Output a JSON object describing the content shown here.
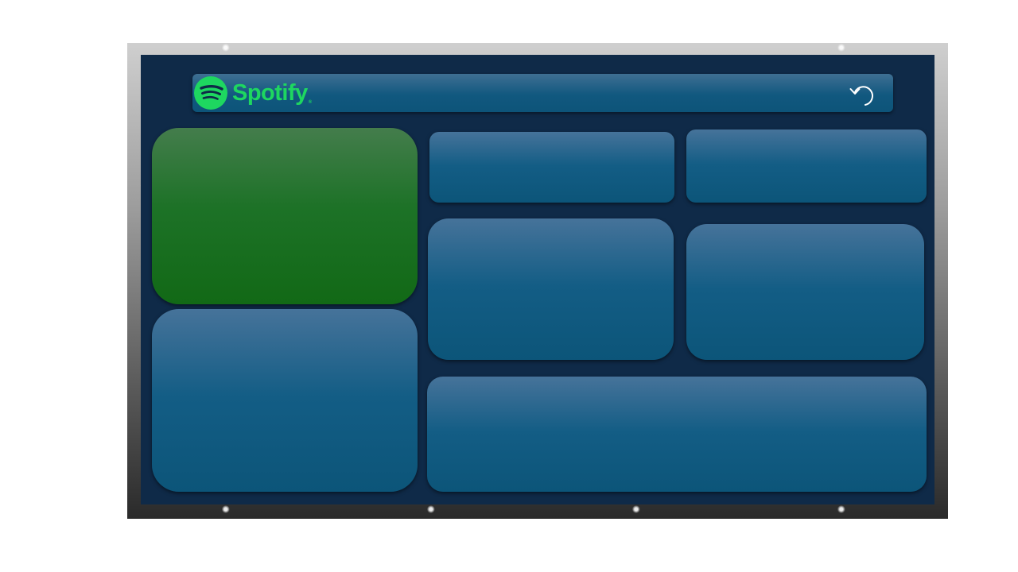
{
  "header": {
    "logo_text": "Spotify",
    "logo_mark": "®",
    "refresh_icon": "refresh-icon"
  },
  "colors": {
    "panel": "#0f2a48",
    "tile": "#0d5479",
    "tile_highlight": "#46739a",
    "active_tile": "#126916",
    "brand": "#1ed760"
  },
  "tiles": [
    {
      "name": "tile-large-top-left",
      "active": true
    },
    {
      "name": "tile-large-bottom-left",
      "active": false
    },
    {
      "name": "tile-small-top-middle",
      "active": false
    },
    {
      "name": "tile-small-top-right",
      "active": false
    },
    {
      "name": "tile-medium-middle",
      "active": false
    },
    {
      "name": "tile-medium-right",
      "active": false
    },
    {
      "name": "tile-wide-bottom",
      "active": false
    }
  ]
}
